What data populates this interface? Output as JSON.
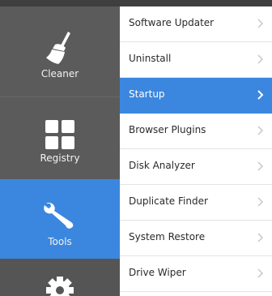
{
  "colors": {
    "nav_bg": "#5b5b5b",
    "active": "#3b87df",
    "menu_bg": "#ffffff",
    "divider": "#e3e3e3",
    "chevron": "#c8c8c8"
  },
  "nav": {
    "items": [
      {
        "label": "Cleaner",
        "icon": "broom-icon"
      },
      {
        "label": "Registry",
        "icon": "grid-icon"
      },
      {
        "label": "Tools",
        "icon": "wrench-icon",
        "active": true
      },
      {
        "label": "",
        "icon": "gear-icon"
      }
    ]
  },
  "menu": {
    "items": [
      {
        "label": "Software Updater"
      },
      {
        "label": "Uninstall"
      },
      {
        "label": "Startup",
        "active": true
      },
      {
        "label": "Browser Plugins"
      },
      {
        "label": "Disk Analyzer"
      },
      {
        "label": "Duplicate Finder"
      },
      {
        "label": "System Restore"
      },
      {
        "label": "Drive Wiper"
      }
    ]
  }
}
